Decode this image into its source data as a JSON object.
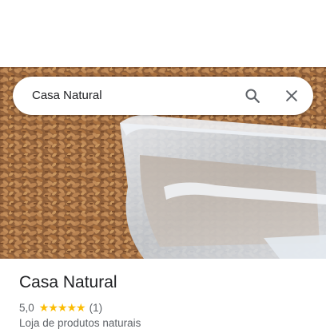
{
  "search": {
    "value": "Casa Natural"
  },
  "place": {
    "title": "Casa Natural",
    "rating": "5,0",
    "stars": [
      "★",
      "★",
      "★",
      "★",
      "★"
    ],
    "review_count": "(1)",
    "category": "Loja de produtos naturais"
  },
  "icons": {
    "search": "search-icon",
    "close": "close-icon",
    "star": "star-icon"
  },
  "colors": {
    "star": "#fbbc04",
    "text_primary": "#202124",
    "text_secondary": "#5f6368",
    "icon": "#5f6368"
  }
}
